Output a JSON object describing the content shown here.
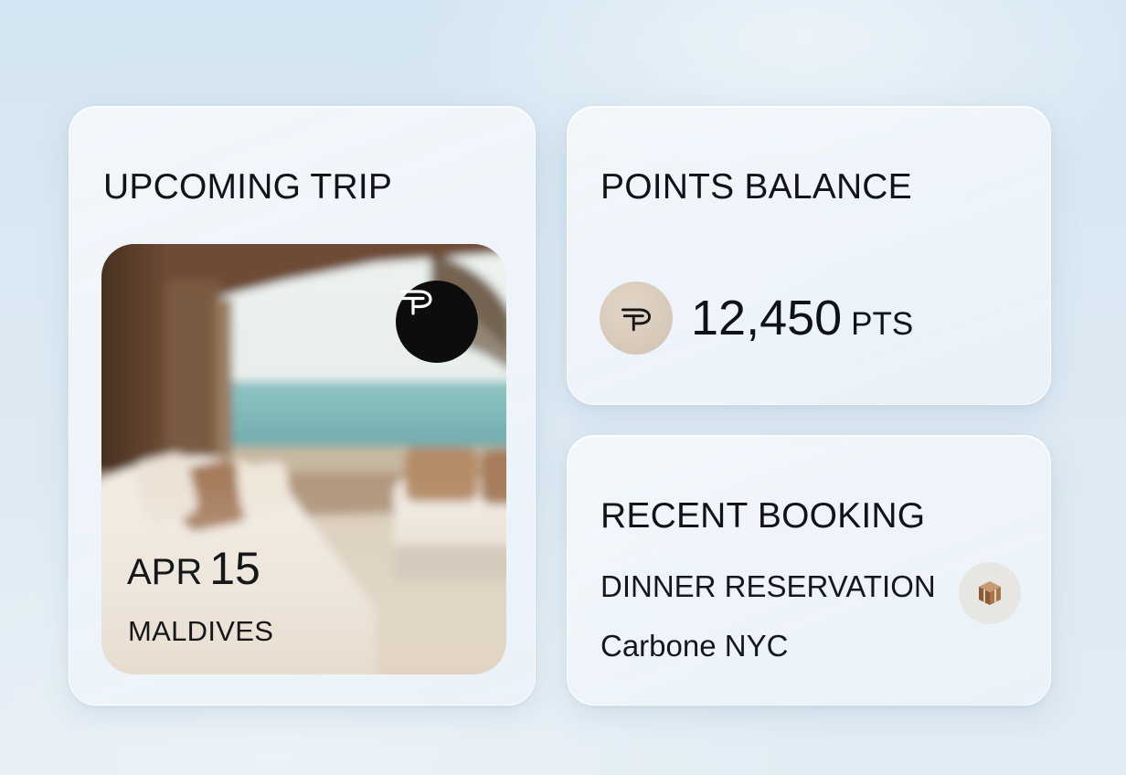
{
  "upcoming_trip": {
    "title": "UPCOMING TRIP",
    "date_month": "APR",
    "date_day": "15",
    "destination": "MALDIVES",
    "brand_icon": "brand-logo-icon"
  },
  "points_balance": {
    "title": "POINTS BALANCE",
    "value": "12,450",
    "unit": "PTS",
    "coin_icon": "brand-coin-icon"
  },
  "recent_booking": {
    "title": "RECENT BOOKING",
    "type": "DINNER RESERVATION",
    "venue": "Carbone NYC",
    "icon": "box-icon"
  },
  "colors": {
    "background": "#d8e7f3",
    "card": "#eef3f9",
    "text": "#111418",
    "brand_badge": "#0d0d0d",
    "coin": "#d9ccbd"
  }
}
